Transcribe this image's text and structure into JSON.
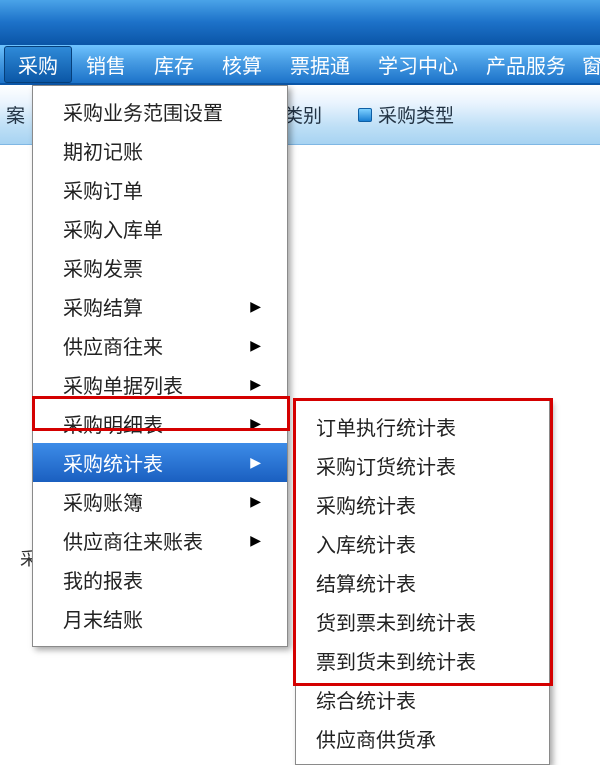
{
  "menubar": {
    "items": [
      "采购",
      "销售",
      "库存",
      "核算",
      "票据通",
      "学习中心",
      "产品服务"
    ],
    "cut_right": "窗"
  },
  "ribbon": {
    "left_cut": "案",
    "label_category": "类别",
    "label_type": "采购类型"
  },
  "side_cut": "采",
  "dropdown": {
    "items": [
      {
        "label": "采购业务范围设置",
        "arrow": false
      },
      {
        "label": "期初记账",
        "arrow": false
      },
      {
        "label": "采购订单",
        "arrow": false
      },
      {
        "label": "采购入库单",
        "arrow": false
      },
      {
        "label": "采购发票",
        "arrow": false
      },
      {
        "label": "采购结算",
        "arrow": true
      },
      {
        "label": "供应商往来",
        "arrow": true
      },
      {
        "label": "采购单据列表",
        "arrow": true
      },
      {
        "label": "采购明细表",
        "arrow": true
      },
      {
        "label": "采购统计表",
        "arrow": true,
        "hi": true
      },
      {
        "label": "采购账簿",
        "arrow": true
      },
      {
        "label": "供应商往来账表",
        "arrow": true
      },
      {
        "label": "我的报表",
        "arrow": false
      },
      {
        "label": "月末结账",
        "arrow": false
      }
    ]
  },
  "submenu": {
    "items": [
      "订单执行统计表",
      "采购订货统计表",
      "采购统计表",
      "入库统计表",
      "结算统计表",
      "货到票未到统计表",
      "票到货未到统计表",
      "综合统计表",
      "供应商供货承"
    ]
  }
}
